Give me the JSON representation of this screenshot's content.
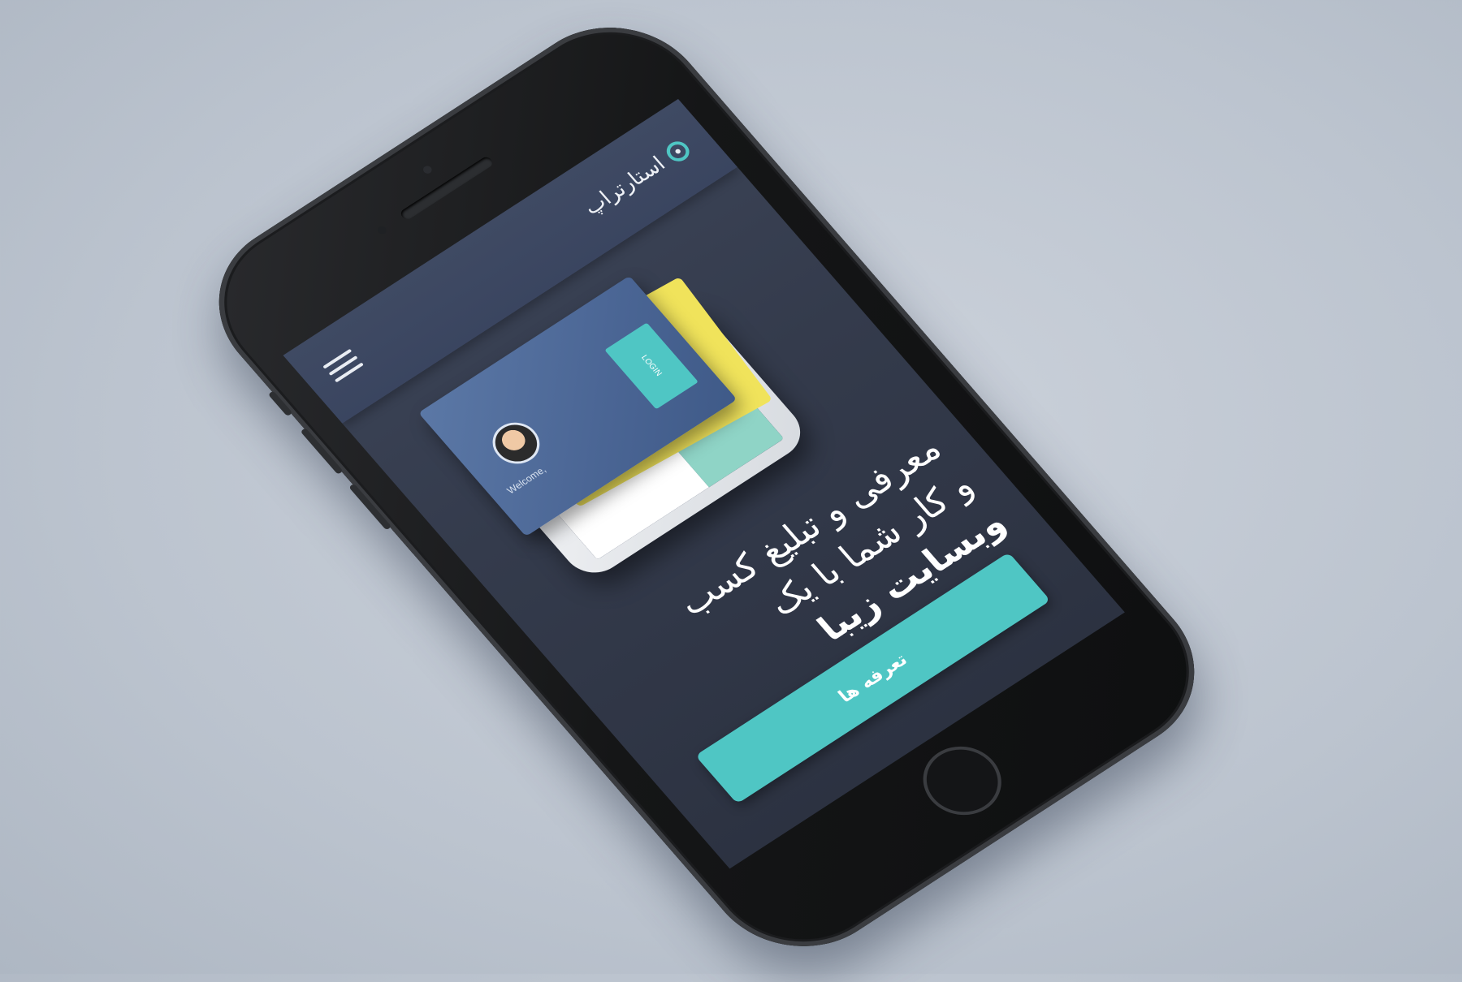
{
  "header": {
    "brand_name": "استارتراپ",
    "menu_icon": "hamburger-menu-icon",
    "logo_icon": "brand-logo-icon"
  },
  "hero": {
    "mockup_welcome_text": "Welcome,",
    "mockup_login_label": "LOGIN",
    "headline_line1": "معرفی و تبلیغ کسب",
    "headline_line2": "و کار شما با یک",
    "headline_line3": "وبسایت زیبا",
    "cta_label": "تعرفه ها"
  },
  "colors": {
    "accent": "#4fc6c4",
    "screen_bg": "#343b4c",
    "topbar_bg": "#3c4761",
    "background": "#c2c9d3",
    "phone_body": "#151617"
  }
}
